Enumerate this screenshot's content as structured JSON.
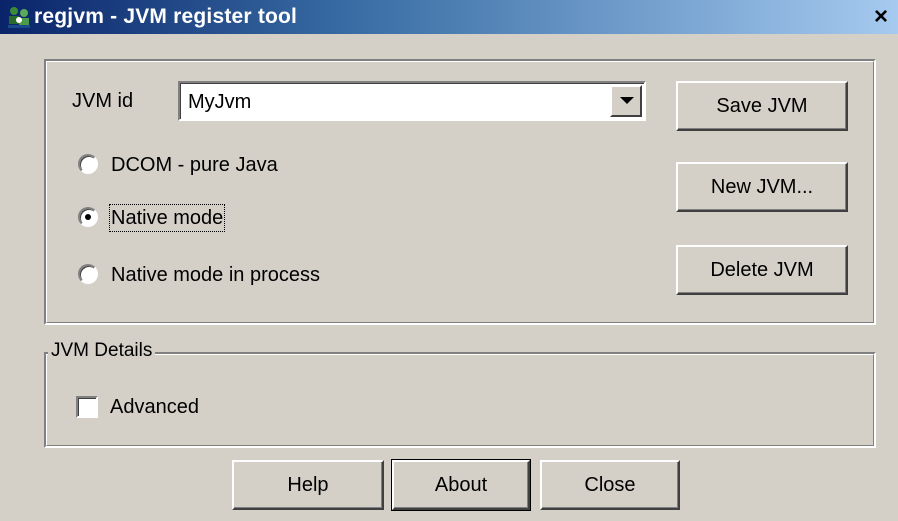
{
  "window": {
    "title": "regjvm - JVM register tool",
    "close_glyph": "×",
    "app_icon": "people-network-icon"
  },
  "main": {
    "jvm_id_label": "JVM id",
    "jvm_id_value": "MyJvm",
    "mode_options": [
      {
        "label": "DCOM - pure Java",
        "selected": false
      },
      {
        "label": "Native mode",
        "selected": true
      },
      {
        "label": "Native mode in process",
        "selected": false
      }
    ],
    "buttons": {
      "save": "Save JVM",
      "new": "New JVM...",
      "delete": "Delete JVM"
    }
  },
  "details": {
    "legend": "JVM Details",
    "advanced_label": "Advanced",
    "advanced_checked": false
  },
  "footer": {
    "help": "Help",
    "about": "About",
    "close": "Close"
  },
  "colors": {
    "face": "#d4d0c8",
    "title_start": "#0a246a",
    "title_end": "#a6caf0"
  }
}
